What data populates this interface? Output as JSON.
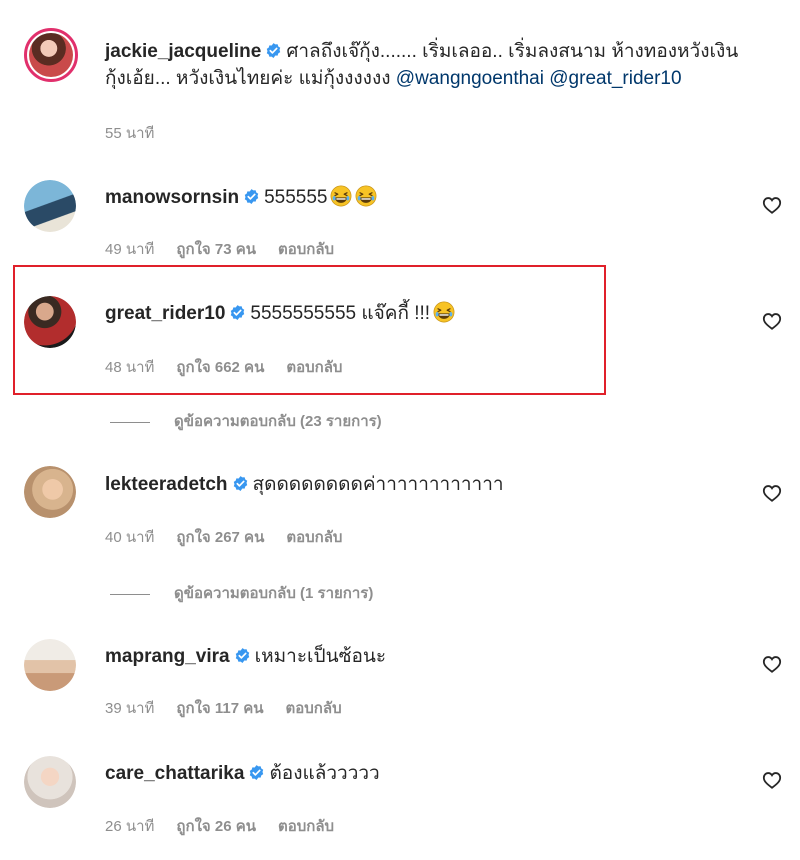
{
  "post_caption": {
    "username": "jackie_jacqueline",
    "text_line1": "ศาลถึงเจ๊กุ้ง....... เริ่มเลออ.. เริ่มลงสนาม ห้างทองหวังเงิน",
    "text_line2": "กุ้งเอ้ย... หวังเงินไทยค่ะ แม่กุ้งงงงงง",
    "mention1": "@wangngoenthai",
    "mention2": "@great_rider10",
    "time": "55 นาที"
  },
  "comments": [
    {
      "username": "manowsornsin",
      "text": "555555",
      "time": "49 นาที",
      "likes": "ถูกใจ 73 คน",
      "reply": "ตอบกลับ"
    },
    {
      "username": "great_rider10",
      "text": "5555555555 แจ๊คกี้ !!!",
      "time": "48 นาที",
      "likes": "ถูกใจ 662 คน",
      "reply": "ตอบกลับ",
      "view_replies": "ดูข้อความตอบกลับ (23 รายการ)"
    },
    {
      "username": "lekteeradetch",
      "text": "สุดดดดดดดดค่าาาาาาาาาาาา",
      "time": "40 นาที",
      "likes": "ถูกใจ 267 คน",
      "reply": "ตอบกลับ",
      "view_replies": "ดูข้อความตอบกลับ (1 รายการ)"
    },
    {
      "username": "maprang_vira",
      "text": "เหมาะเป็นซ้อนะ",
      "time": "39 นาที",
      "likes": "ถูกใจ 117 คน",
      "reply": "ตอบกลับ"
    },
    {
      "username": "care_chattarika",
      "text": "ต้องแล้ววววว",
      "time": "26 นาที",
      "likes": "ถูกใจ 26 คน",
      "reply": "ตอบกลับ"
    }
  ],
  "icons": {
    "verified": "verified-badge-icon",
    "like": "heart-outline-icon",
    "emoji": "grinning-squinting-face-emoji"
  },
  "colors": {
    "verified": "#3897f0",
    "mention": "#00376b",
    "highlight_border": "#e0202a",
    "story_ring": "#e1306c",
    "meta": "#8e8e8e"
  }
}
